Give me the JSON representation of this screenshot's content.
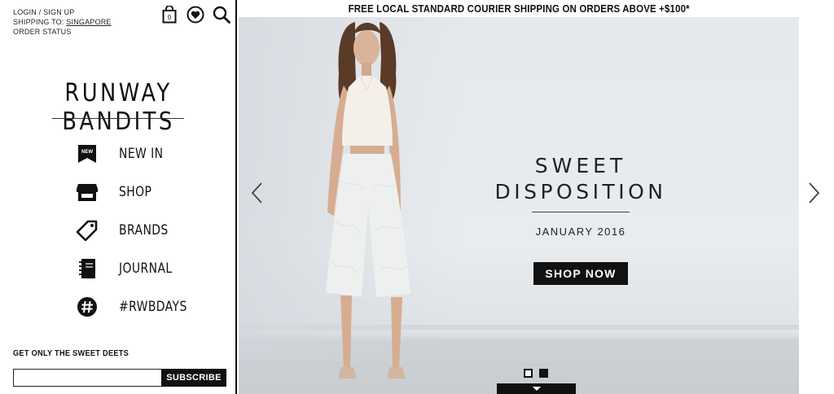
{
  "account": {
    "login": "LOGIN / SIGN UP",
    "shipping_label": "SHIPPING TO:",
    "shipping_country": "SINGAPORE",
    "order_status": "ORDER STATUS"
  },
  "tools": {
    "cart_count": "0",
    "icons": [
      "bag-icon",
      "heart-icon",
      "search-icon"
    ]
  },
  "brand": {
    "logo": "RUNWAY BANDITS"
  },
  "nav": {
    "items": [
      {
        "label": "NEW IN",
        "icon": "new-tag-icon"
      },
      {
        "label": "SHOP",
        "icon": "storefront-icon"
      },
      {
        "label": "BRANDS",
        "icon": "price-tag-icon"
      },
      {
        "label": "JOURNAL",
        "icon": "notebook-icon"
      },
      {
        "label": "#RWBDAYS",
        "icon": "hashtag-icon"
      }
    ],
    "new_badge": "NEW"
  },
  "newsletter": {
    "title": "GET ONLY THE SWEET DEETS",
    "input_value": "",
    "button": "SUBSCRIBE"
  },
  "banner": {
    "text": "FREE LOCAL STANDARD COURIER SHIPPING ON ORDERS ABOVE +$100*"
  },
  "hero": {
    "title_line1": "SWEET",
    "title_line2": "DISPOSITION",
    "subtitle": "JANUARY 2016",
    "cta": "SHOP NOW",
    "slide_count": 2,
    "active_slide": 2
  },
  "colors": {
    "text": "#111111",
    "button_bg": "#111111",
    "hero_wall": "#e8ebee"
  }
}
